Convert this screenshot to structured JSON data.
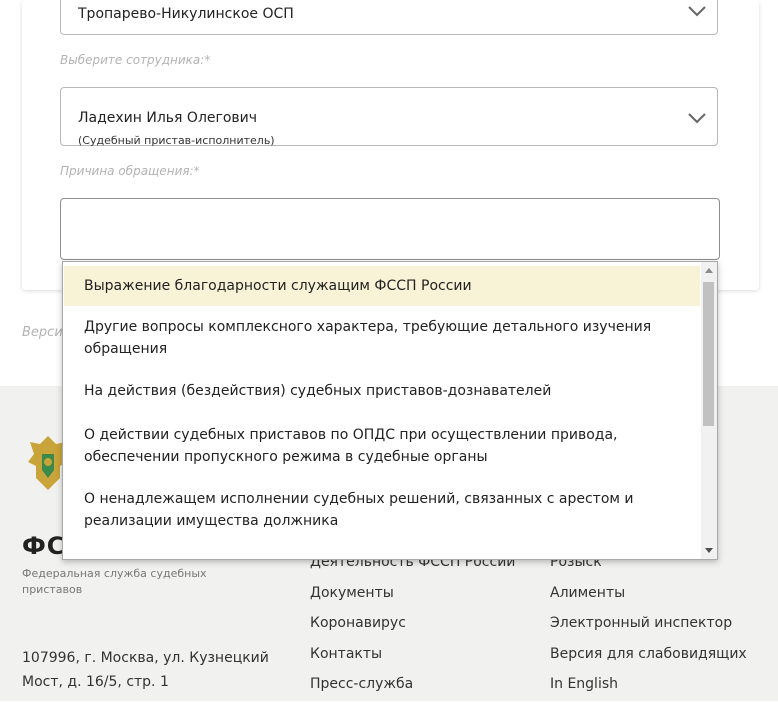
{
  "form": {
    "department_value": "Тропарево-Никулинское ОСП",
    "employee_label": "Выберите сотрудника:*",
    "employee_name": "Ладехин Илья Олегович",
    "employee_role": "(Судебный пристав-исполнитель)",
    "reason_label": "Причина обращения:*",
    "reason_value": ""
  },
  "reason_options": [
    "Выражение благодарности служащим ФССП России",
    "Другие вопросы комплексного характера, требующие детального изучения обращения",
    "На действия (бездействия) судебных приставов-дознавателей",
    "О действии судебных приставов по ОПДС при осуществлении привода, обеспечении пропускного режима в судебные органы",
    "О ненадлежащем исполнении судебных решений, связанных с арестом и реализации имущества должника"
  ],
  "highlight_color": "#f8f3d6",
  "version_text": "Верси",
  "footer": {
    "brand": "ФС",
    "brand_subtitle": "Федеральная служба судебных приставов",
    "address": "107996, г. Москва, ул. Кузнецкий Мост, д. 16/5, стр. 1",
    "col1": [
      "Деятельность ФССП России",
      "Документы",
      "Коронавирус",
      "Контакты",
      "Пресс-служба"
    ],
    "col2": [
      "Розыск",
      "Алименты",
      "Электронный инспектор",
      "Версия для слабовидящих",
      "In English"
    ],
    "background": "#f1f1ef"
  }
}
